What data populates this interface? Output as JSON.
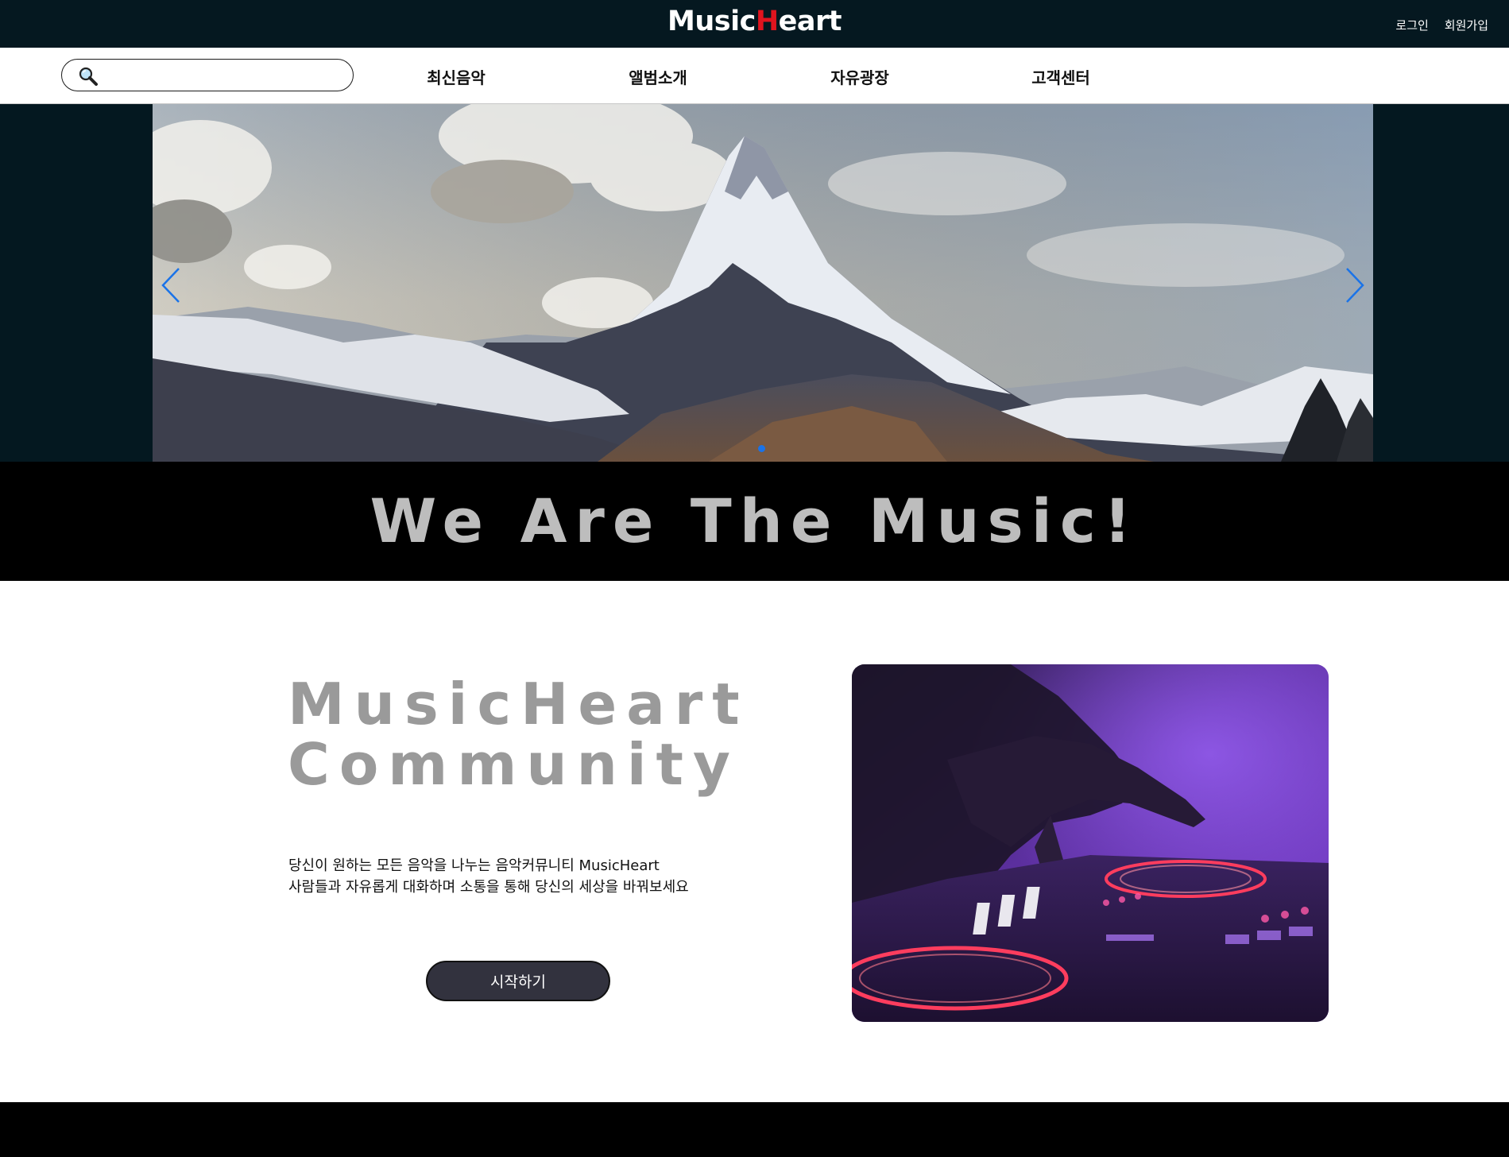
{
  "header": {
    "logo": {
      "part1": "Music",
      "accent": "H",
      "part2": "eart"
    },
    "login": "로그인",
    "signup": "회원가입"
  },
  "nav": {
    "search": {
      "value": "",
      "placeholder": ""
    },
    "items": [
      "최신음악",
      "앨범소개",
      "자유광장",
      "고객센터"
    ]
  },
  "hero": {
    "slide_image": "mountain-peak-photo",
    "active_slide": 1
  },
  "tagline": "We Are The Music!",
  "community": {
    "title_line1": "MusicHeart",
    "title_line2": "Community",
    "desc_line1": "당신이 원하는 모든 음악을 나누는 음악커뮤니티 MusicHeart",
    "desc_line2": "사람들과 자유롭게 대화하며 소통을 통해 당신의 세상을 바꿔보세요",
    "start_button": "시작하기",
    "image": "dj-mixer-photo"
  },
  "colors": {
    "topbar": "#051820",
    "logo_accent": "#e0141e",
    "tagline_band": "#000000",
    "tagline_text": "#bdbdbd",
    "title_gray": "#9a9a9a",
    "button": "#32323e",
    "carousel_accent": "#1a73e8"
  }
}
